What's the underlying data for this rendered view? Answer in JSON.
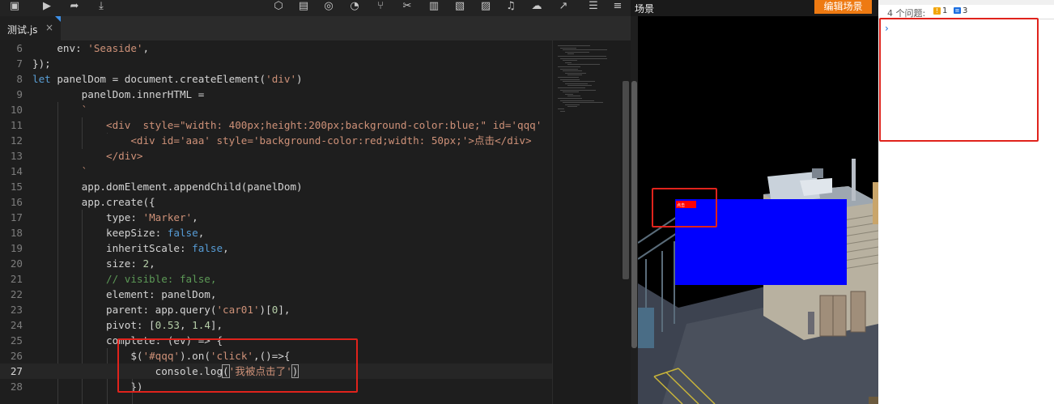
{
  "toolbar": {
    "icons": [
      "save-icon",
      "run-icon",
      "share-icon",
      "download-icon",
      "cube-icon",
      "book-icon",
      "palette-icon",
      "pie-icon",
      "tree-icon",
      "crop-icon",
      "layout-icon",
      "image-icon",
      "gallery-icon",
      "music-icon",
      "cloud-icon",
      "chart-icon",
      "note-icon",
      "sliders-icon"
    ]
  },
  "editor": {
    "tab_label": "测试.js",
    "tab_close": "×",
    "lines": [
      {
        "num": "6",
        "html": "<span>    env: </span><span class=\"s\">'Seaside'</span><span>,</span>"
      },
      {
        "num": "7",
        "html": "<span>});</span>"
      },
      {
        "num": "8",
        "html": "<span class=\"k\">let</span><span> panelDom = document.createElement(</span><span class=\"s\">'div'</span><span>)</span>"
      },
      {
        "num": "9",
        "html": "<span>        panelDom.innerHTML =</span>"
      },
      {
        "num": "10",
        "html": "<span class=\"s\">        `</span>"
      },
      {
        "num": "11",
        "html": "<span class=\"s\">            &lt;div  style=\"width: 400px;height:200px;background-color:blue;\" id='qqq'</span>"
      },
      {
        "num": "12",
        "html": "<span class=\"s\">                &lt;div id='aaa' style='background-color:red;width: 50px;'&gt;点击&lt;/div&gt;</span>"
      },
      {
        "num": "13",
        "html": "<span class=\"s\">            &lt;/div&gt;</span>"
      },
      {
        "num": "14",
        "html": "<span class=\"s\">        `</span>"
      },
      {
        "num": "15",
        "html": "<span>        app.domElement.appendChild(panelDom)</span>"
      },
      {
        "num": "16",
        "html": "<span>        app.create({</span>"
      },
      {
        "num": "17",
        "html": "<span>            type: </span><span class=\"s\">'Marker'</span><span>,</span>"
      },
      {
        "num": "18",
        "html": "<span>            keepSize: </span><span class=\"b\">false</span><span>,</span>"
      },
      {
        "num": "19",
        "html": "<span>            inheritScale: </span><span class=\"b\">false</span><span>,</span>"
      },
      {
        "num": "20",
        "html": "<span>            size: </span><span class=\"n\">2</span><span>,</span>"
      },
      {
        "num": "21",
        "html": "<span class=\"c\">            // visible: false,</span>"
      },
      {
        "num": "22",
        "html": "<span>            element: panelDom,</span>"
      },
      {
        "num": "23",
        "html": "<span>            parent: app.query(</span><span class=\"s\">'car01'</span><span>)[</span><span class=\"n\">0</span><span>],</span>"
      },
      {
        "num": "24",
        "html": "<span>            pivot: [</span><span class=\"n\">0.53</span><span>, </span><span class=\"n\">1.4</span><span>],</span>"
      },
      {
        "num": "25",
        "html": "<span>            complete: (ev) =&gt; {</span>"
      },
      {
        "num": "26",
        "html": "<span>                $(</span><span class=\"s\">'#qqq'</span><span>).on(</span><span class=\"s\">'click'</span><span>,()=&gt;{</span>"
      },
      {
        "num": "27",
        "html": "<span>                    console.log</span><span class=\"bracket-hl\">(</span><span class=\"s\">'我被点击了'</span><span class=\"bracket-hl\">)</span>"
      },
      {
        "num": "28",
        "html": "<span>                })</span>"
      }
    ],
    "current_line": "27"
  },
  "scene": {
    "title": "场景",
    "edit_button": "编辑场景",
    "marker_label": "点击"
  },
  "console": {
    "issues_label": "4 个问题:",
    "warnings_count": "1",
    "info_count": "3",
    "warn_glyph": "!",
    "info_glyph": "≡",
    "prompt": "›"
  },
  "colors": {
    "annotation": "#e0231c",
    "accent_orange": "#ee7a12",
    "marker_blue": "#0000ff",
    "marker_red": "#ff0000"
  }
}
